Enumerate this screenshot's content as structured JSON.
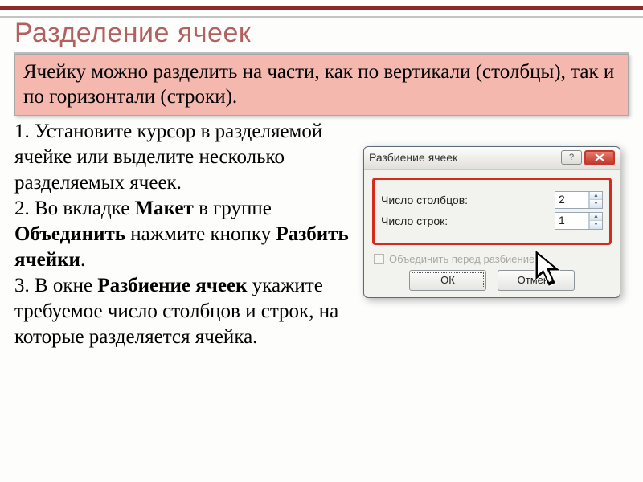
{
  "slide": {
    "title": "Разделение ячеек",
    "highlight": "Ячейку можно разделить на части, как по вертикали (столбцы), так и по горизонтали (строки).",
    "step1": "1. Установите курсор в разделяемой ячейке или выделите несколько разделяемых ячеек.",
    "step2_pre": "2. Во вкладке ",
    "step2_b1": "Макет",
    "step2_mid": " в группе ",
    "step2_b2": "Объединить",
    "step2_mid2": " нажмите кнопку ",
    "step2_b3": "Разбить ячейки",
    "step2_end": ".",
    "step3_pre": "3. В окне ",
    "step3_b1": "Разбиение ячеек",
    "step3_end": "  укажите требуемое число столбцов и строк, на которые разделяется ячейка."
  },
  "dialog": {
    "title": "Разбиение ячеек",
    "cols_label": "Число столбцов:",
    "rows_label": "Число строк:",
    "cols_value": "2",
    "rows_value": "1",
    "checkbox_label": "Объединить перед разбиением",
    "ok": "ОК",
    "cancel": "Отмена",
    "help_icon": "?"
  }
}
